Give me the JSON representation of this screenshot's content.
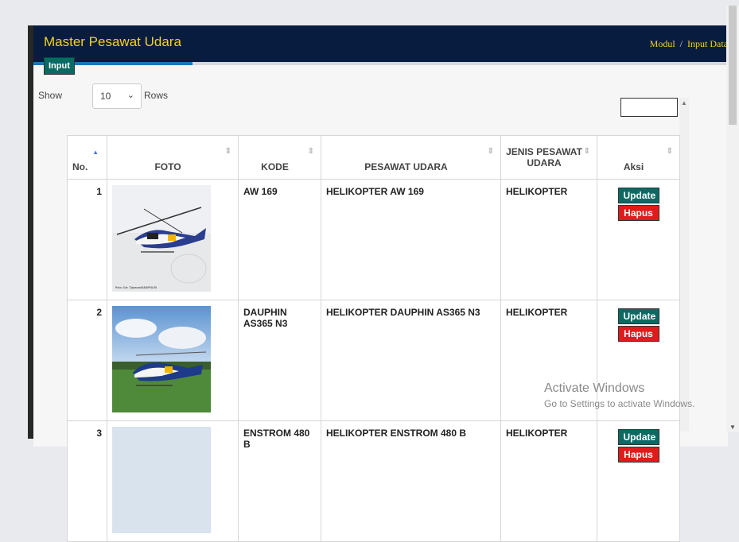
{
  "header": {
    "title": "Master Pesawat Udara",
    "crumb_1": "Modul",
    "crumb_sep": "/",
    "crumb_2": "Input Data"
  },
  "toolbar": {
    "input_label": "Input",
    "show_label": "Show",
    "rows_value": "10",
    "rows_label": "Rows",
    "search_value": ""
  },
  "table": {
    "columns": [
      "No.",
      "FOTO",
      "KODE",
      "PESAWAT UDARA",
      "JENIS PESAWAT UDARA",
      "Aksi"
    ],
    "rows": [
      {
        "no": "1",
        "kode": "AW 169",
        "pesawat": "HELIKOPTER AW 169",
        "jenis": "HELIKOPTER",
        "update": "Update",
        "hapus": "Hapus",
        "photo_caption": "Foto: Cdr. Tjepsum/DAS/POLRI"
      },
      {
        "no": "2",
        "kode": "DAUPHIN AS365 N3",
        "pesawat": "HELIKOPTER DAUPHIN AS365 N3",
        "jenis": "HELIKOPTER",
        "update": "Update",
        "hapus": "Hapus",
        "photo_caption": ""
      },
      {
        "no": "3",
        "kode": "ENSTROM 480 B",
        "pesawat": "HELIKOPTER ENSTROM 480 B",
        "jenis": "HELIKOPTER",
        "update": "Update",
        "hapus": "Hapus",
        "photo_caption": ""
      }
    ]
  },
  "watermark": {
    "line1": "Activate Windows",
    "line2": "Go to Settings to activate Windows."
  },
  "colors": {
    "header_bg": "#071c3f",
    "title": "#f4d21e",
    "accent": "#1f74b8",
    "update_btn": "#0b6b63",
    "hapus_btn": "#e01b1b"
  }
}
